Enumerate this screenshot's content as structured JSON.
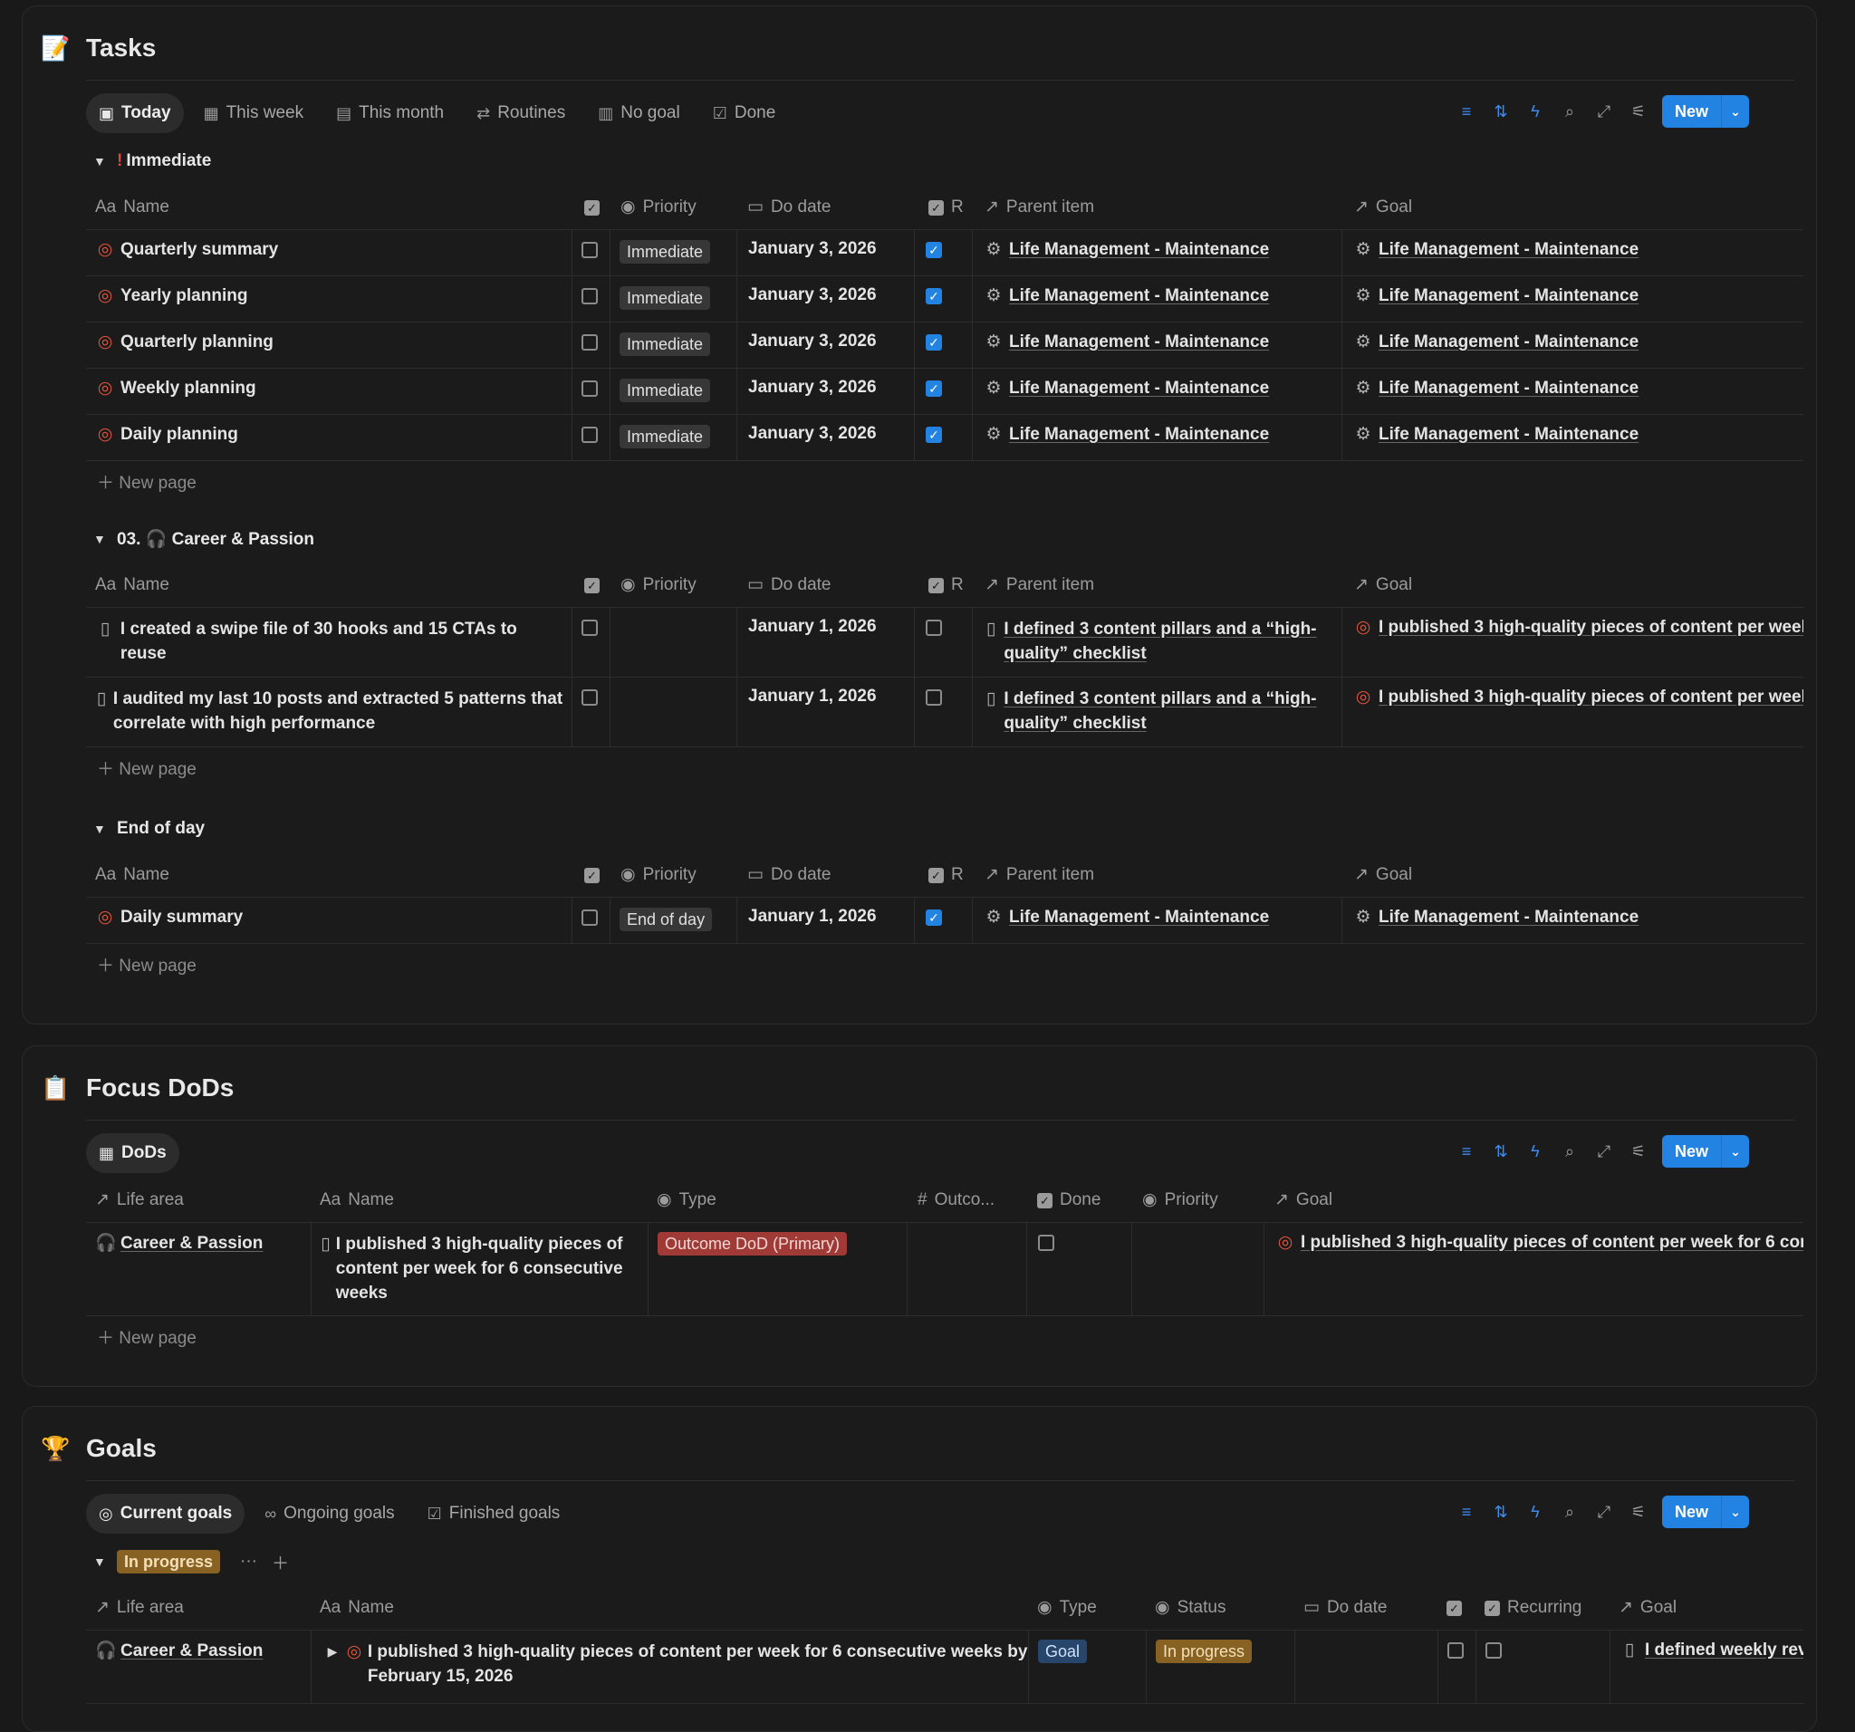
{
  "tasks": {
    "title": "Tasks",
    "tabs": [
      {
        "label": "Today",
        "icon": "calendar-day-icon"
      },
      {
        "label": "This week",
        "icon": "calendar-week-icon"
      },
      {
        "label": "This month",
        "icon": "calendar-month-icon"
      },
      {
        "label": "Routines",
        "icon": "repeat-icon"
      },
      {
        "label": "No goal",
        "icon": "gift-icon"
      },
      {
        "label": "Done",
        "icon": "checkbox-icon"
      }
    ],
    "new_label": "New",
    "columns": {
      "name": "Name",
      "priority": "Priority",
      "do_date": "Do date",
      "r": "R",
      "parent": "Parent item",
      "goal": "Goal"
    },
    "new_page": "New page",
    "groups": [
      {
        "label": "Immediate",
        "prefix": "!",
        "rows": [
          {
            "name": "Quarterly summary",
            "priority": "Immediate",
            "date": "January 3, 2026",
            "parent": "Life Management - Maintenance",
            "goal": "Life Management - Maintenance"
          },
          {
            "name": "Yearly planning",
            "priority": "Immediate",
            "date": "January 3, 2026",
            "parent": "Life Management - Maintenance",
            "goal": "Life Management - Maintenance"
          },
          {
            "name": "Quarterly planning",
            "priority": "Immediate",
            "date": "January 3, 2026",
            "parent": "Life Management - Maintenance",
            "goal": "Life Management - Maintenance"
          },
          {
            "name": "Weekly planning",
            "priority": "Immediate",
            "date": "January 3, 2026",
            "parent": "Life Management - Maintenance",
            "goal": "Life Management - Maintenance"
          },
          {
            "name": "Daily planning",
            "priority": "Immediate",
            "date": "January 3, 2026",
            "parent": "Life Management - Maintenance",
            "goal": "Life Management - Maintenance"
          }
        ]
      },
      {
        "label": "03. 🎧 Career & Passion",
        "rows": [
          {
            "name": "I created a swipe file of 30 hooks and 15 CTAs to reuse",
            "date": "January 1, 2026",
            "parent": "I defined 3 content pillars and a “high-quality” checklist",
            "goal": "I published 3 high-quality pieces of content per week"
          },
          {
            "name": "I audited my last 10 posts and extracted 5 patterns that correlate with high performance",
            "date": "January 1, 2026",
            "parent": "I defined 3 content pillars and a “high-quality” checklist",
            "goal": "I published 3 high-quality pieces of content per week"
          }
        ]
      },
      {
        "label": "End of day",
        "rows": [
          {
            "name": "Daily summary",
            "priority": "End of day",
            "date": "January 1, 2026",
            "parent": "Life Management - Maintenance",
            "goal": "Life Management - Maintenance"
          }
        ]
      }
    ]
  },
  "dods": {
    "title": "Focus DoDs",
    "tab": "DoDs",
    "new_label": "New",
    "columns": {
      "life_area": "Life area",
      "name": "Name",
      "type": "Type",
      "outcome": "Outco...",
      "done": "Done",
      "priority": "Priority",
      "goal": "Goal"
    },
    "row": {
      "life_area": "Career & Passion",
      "name": "I published 3 high-quality pieces of content per week for 6 consecutive weeks",
      "type": "Outcome DoD (Primary)",
      "goal": "I published 3 high-quality pieces of content per week for 6 cons"
    },
    "new_page": "New page"
  },
  "goals": {
    "title": "Goals",
    "tabs": [
      {
        "label": "Current goals",
        "icon": "target-icon"
      },
      {
        "label": "Ongoing goals",
        "icon": "infinity-icon"
      },
      {
        "label": "Finished goals",
        "icon": "checkbox-icon"
      }
    ],
    "new_label": "New",
    "group_label": "In progress",
    "columns": {
      "life_area": "Life area",
      "name": "Name",
      "type": "Type",
      "status": "Status",
      "do_date": "Do date",
      "recurring": "Recurring",
      "goal": "Goal"
    },
    "row": {
      "life_area": "Career & Passion",
      "name": "I published 3 high-quality pieces of content per week for 6 consecutive weeks by February 15, 2026",
      "type": "Goal",
      "status": "In progress",
      "goal": "I defined weekly revi"
    }
  }
}
